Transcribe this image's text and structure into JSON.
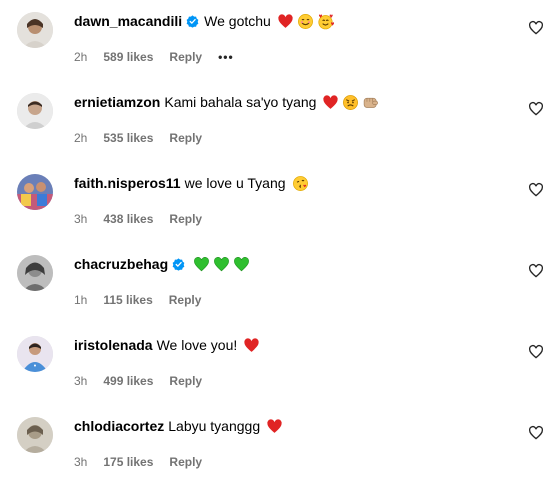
{
  "colors": {
    "meta": "#737373",
    "verified": "#0095f6",
    "heart": "#e02424",
    "green_heart": "#2fbf2f"
  },
  "comments": [
    {
      "username": "dawn_macandili",
      "verified": true,
      "text": "We gotchu",
      "emojis": [
        "red-heart",
        "smiling-face",
        "smiling-face-with-hearts"
      ],
      "time": "2h",
      "likes": "589 likes",
      "reply": "Reply",
      "more": "•••"
    },
    {
      "username": "ernietiamzon",
      "verified": false,
      "text": "Kami bahala sa'yo tyang",
      "emojis": [
        "red-heart",
        "pouting-face",
        "fist"
      ],
      "time": "2h",
      "likes": "535 likes",
      "reply": "Reply"
    },
    {
      "username": "faith.nisperos11",
      "verified": false,
      "text": "we love u Tyang",
      "emojis": [
        "face-blowing-kiss"
      ],
      "time": "3h",
      "likes": "438 likes",
      "reply": "Reply"
    },
    {
      "username": "chacruzbehag",
      "verified": true,
      "text": "",
      "emojis": [
        "green-heart",
        "green-heart",
        "green-heart"
      ],
      "time": "1h",
      "likes": "115 likes",
      "reply": "Reply"
    },
    {
      "username": "iristolenada",
      "verified": false,
      "text": "We love you!",
      "emojis": [
        "red-heart"
      ],
      "time": "3h",
      "likes": "499 likes",
      "reply": "Reply"
    },
    {
      "username": "chlodiacortez",
      "verified": false,
      "text": "Labyu tyanggg",
      "emojis": [
        "red-heart"
      ],
      "time": "3h",
      "likes": "175 likes",
      "reply": "Reply"
    }
  ]
}
